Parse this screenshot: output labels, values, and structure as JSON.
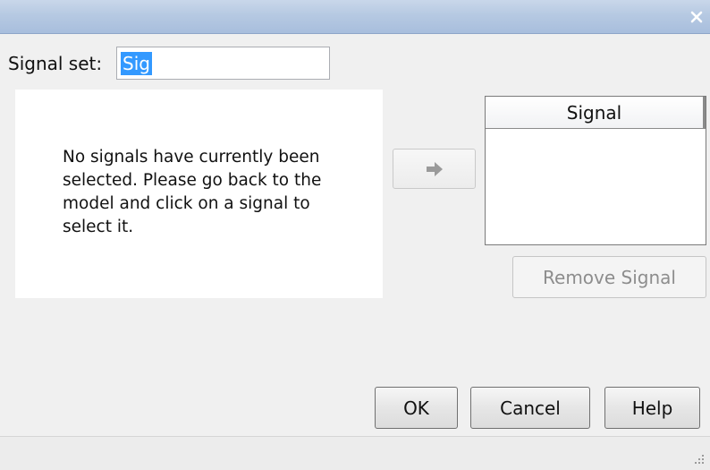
{
  "window": {
    "title": "",
    "close_icon": "close-icon",
    "titlebar_color": "#b6c9e2"
  },
  "signal_set": {
    "label": "Signal set:",
    "value": "Sig"
  },
  "message_panel": {
    "text": "No signals have currently been selected. Please go back to the model and click on a signal to select it."
  },
  "add_button": {
    "icon": "arrow-right-icon",
    "enabled": false
  },
  "signal_list": {
    "column_header": "Signal",
    "rows": []
  },
  "buttons": {
    "remove_signal": "Remove Signal",
    "ok": "OK",
    "cancel": "Cancel",
    "help": "Help"
  },
  "status_bar": {
    "grip_icon": "resize-grip-icon"
  }
}
